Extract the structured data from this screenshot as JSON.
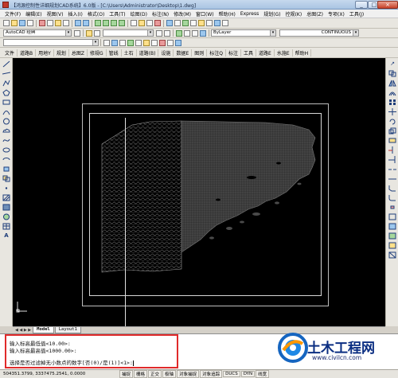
{
  "window": {
    "title": "【鸿源控制性详细规划CAD系统】6.0版 - [C:\\Users\\Administrator\\Desktop\\1.dwg]",
    "minimize": "_",
    "maximize": "□",
    "close": "×"
  },
  "menu": [
    "文件(F)",
    "编辑(E)",
    "视图(V)",
    "插入(I)",
    "格式(O)",
    "工具(T)",
    "绘图(D)",
    "标注(N)",
    "修改(M)",
    "窗口(W)",
    "帮助(H)",
    "Express",
    "规划(G)",
    "控规(K)",
    "总图(Z)",
    "专项(X)",
    "工具(J)"
  ],
  "toolbar": {
    "workspace": "AutoCAD 经典",
    "layer_combo": "ByLayer",
    "linetype_combo": "CONTINUOUS"
  },
  "plugin_menu": [
    "文件",
    "道路B",
    "用地Y",
    "规划",
    "总图Z",
    "修规G",
    "管线",
    "土石",
    "道路(B)",
    "设施",
    "数据E",
    "图则",
    "标注Q",
    "标注",
    "工具",
    "道路E",
    "水施E",
    "帮助H"
  ],
  "right_tool_arrow": "↗",
  "layout_tabs": {
    "nav": "◀ ◀ ▶ ▶",
    "model": "Model",
    "layout1": "Layout1"
  },
  "command": {
    "lines": [
      "输入标高最低值<10.00>:",
      "输入标高最高值<1000.00>:",
      "选择是否过滤掉无小数点的数字[否(0)/是(1)]<1>:"
    ]
  },
  "status": {
    "coords": "504351.3799, 3337475.2541, 0.0000",
    "buttons": [
      "捕捉",
      "栅格",
      "正交",
      "极轴",
      "对象捕捉",
      "对象追踪",
      "DUCS",
      "DYN",
      "线宽"
    ]
  },
  "watermark": {
    "title": "土木工程网",
    "url": "www.civilcn.com"
  }
}
